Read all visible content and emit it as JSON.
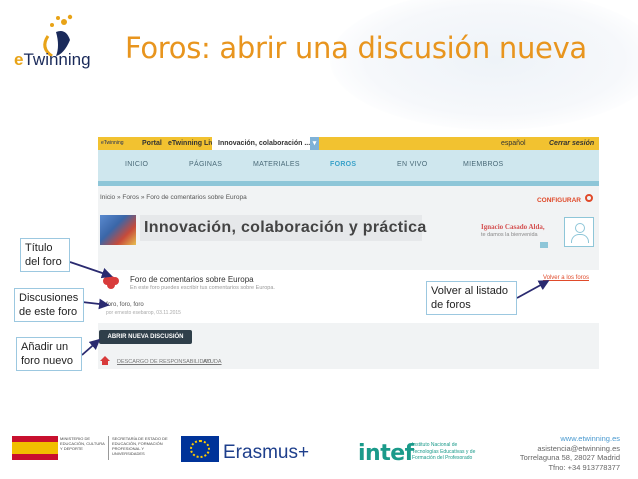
{
  "slide": {
    "title": "Foros: abrir una discusión nueva",
    "logo_text_e": "e",
    "logo_text_rest": "Twinning"
  },
  "topbar": {
    "portal": "Portal",
    "live": "eTwinning Live",
    "active_tab": "Innovación, colaboración ...",
    "tab_arrow": "▾",
    "language": "español",
    "logout": "Cerrar sesión"
  },
  "nav": {
    "items": [
      "INICIO",
      "PÁGINAS",
      "MATERIALES",
      "FOROS",
      "EN VIVO",
      "MIEMBROS"
    ],
    "selected": "FOROS"
  },
  "breadcrumb": "Inicio  »  Foros  »  Foro de comentarios sobre Europa",
  "configure": "CONFIGURAR",
  "group": {
    "title": "Innovación, colaboración y práctica"
  },
  "user": {
    "name": "Ignacio Casado Alda,",
    "welcome": "te damos la bienvenida"
  },
  "forum": {
    "name": "Foro de comentarios sobre Europa",
    "description": "En este foro puedes escribir tus comentarios sobre Europa.",
    "back_link": "Volver a los foros",
    "discussion_title": "foro, foro, foro",
    "discussion_meta": "por ernesto esebarop, 03.11.2015"
  },
  "open_button": "ABRIR NUEVA DISCUSIÓN",
  "footer_links": {
    "disclaimer": "DESCARGO DE RESPONSABILIDAD",
    "help": "AYUDA"
  },
  "callouts": {
    "title": "Título del foro",
    "discussions": "Discusiones de este foro",
    "new_forum": "Añadir un foro nuevo",
    "back": "Volver al listado de foros"
  },
  "partners": {
    "gov_text": "MINISTERIO DE EDUCACIÓN, CULTURA Y DEPORTE",
    "gov_text2": "SECRETARÍA DE ESTADO DE EDUCACIÓN, FORMACIÓN PROFESIONAL Y UNIVERSIDADES",
    "erasmus": "Erasmus+",
    "intef": "intef",
    "intef_text": "Instituto Nacional de Tecnologías Educativas y de Formación del Profesorado"
  },
  "contact": {
    "web": "www.etwinning.es",
    "email": "asistencia@etwinning.es",
    "address": "Torrelaguna 58, 28027 Madrid",
    "phone": "Tfno: +34 913778377"
  },
  "colors": {
    "title_orange": "#e8951e",
    "topbar_yellow": "#f2c230",
    "nav_blue": "#cfe7ee",
    "link_red": "#e04a2a",
    "callout_border": "#9cc8e0",
    "arrow_navy": "#2a2a70"
  }
}
